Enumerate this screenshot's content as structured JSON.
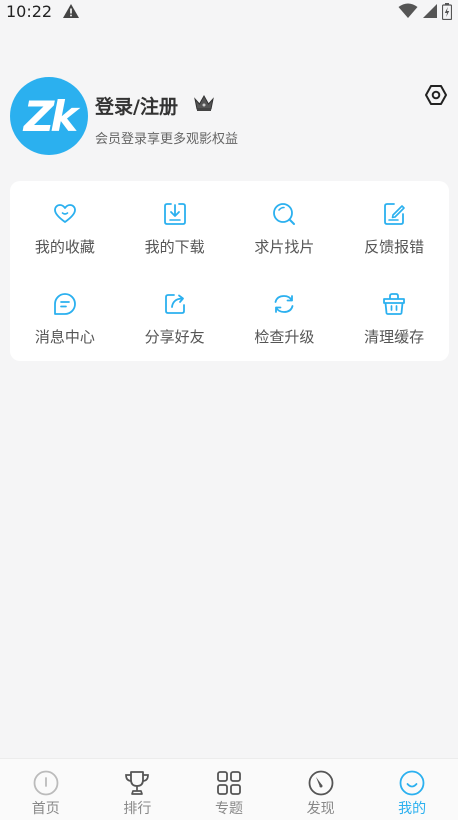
{
  "status_bar": {
    "time": "10:22"
  },
  "profile": {
    "avatar_text": "Zk",
    "login_title": "登录/注册",
    "login_subtitle": "会员登录享更多观影权益"
  },
  "grid": {
    "items": [
      {
        "label": "我的收藏",
        "icon": "heart-icon"
      },
      {
        "label": "我的下载",
        "icon": "download-icon"
      },
      {
        "label": "求片找片",
        "icon": "search-icon"
      },
      {
        "label": "反馈报错",
        "icon": "edit-icon"
      },
      {
        "label": "消息中心",
        "icon": "message-icon"
      },
      {
        "label": "分享好友",
        "icon": "share-icon"
      },
      {
        "label": "检查升级",
        "icon": "refresh-icon"
      },
      {
        "label": "清理缓存",
        "icon": "basket-icon"
      }
    ]
  },
  "nav": {
    "items": [
      {
        "label": "首页",
        "icon": "home-icon",
        "active": false
      },
      {
        "label": "排行",
        "icon": "trophy-icon",
        "active": false
      },
      {
        "label": "专题",
        "icon": "grid-icon",
        "active": false
      },
      {
        "label": "发现",
        "icon": "compass-icon",
        "active": false
      },
      {
        "label": "我的",
        "icon": "smile-icon",
        "active": true
      }
    ]
  },
  "colors": {
    "accent": "#2bb0ef",
    "background": "#f5f5f6",
    "card": "#ffffff"
  }
}
